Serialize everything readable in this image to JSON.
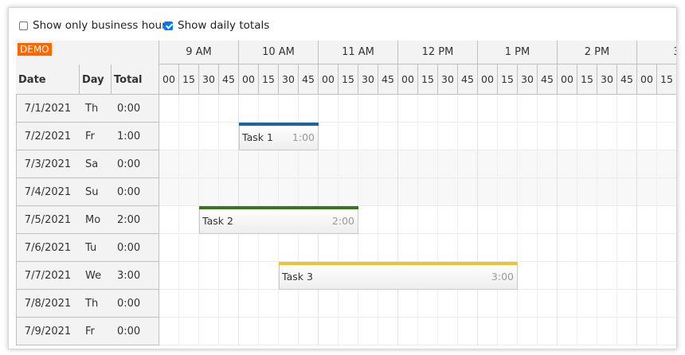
{
  "toolbar": {
    "business_hours_label": "Show only business hours",
    "business_hours_checked": false,
    "daily_totals_label": "Show daily totals",
    "daily_totals_checked": true
  },
  "corner": {
    "demo_badge": "DEMO",
    "columns": [
      "Date",
      "Day",
      "Total"
    ]
  },
  "timeline": {
    "hours": [
      "9 AM",
      "10 AM",
      "11 AM",
      "12 PM",
      "1 PM",
      "2 PM",
      "3"
    ],
    "minutes": [
      "00",
      "15",
      "30",
      "45"
    ]
  },
  "rows": [
    {
      "date": "7/1/2021",
      "day": "Th",
      "total": "0:00",
      "weekend": false
    },
    {
      "date": "7/2/2021",
      "day": "Fr",
      "total": "1:00",
      "weekend": false
    },
    {
      "date": "7/3/2021",
      "day": "Sa",
      "total": "0:00",
      "weekend": true
    },
    {
      "date": "7/4/2021",
      "day": "Su",
      "total": "0:00",
      "weekend": true
    },
    {
      "date": "7/5/2021",
      "day": "Mo",
      "total": "2:00",
      "weekend": false
    },
    {
      "date": "7/6/2021",
      "day": "Tu",
      "total": "0:00",
      "weekend": false
    },
    {
      "date": "7/7/2021",
      "day": "We",
      "total": "3:00",
      "weekend": false
    },
    {
      "date": "7/8/2021",
      "day": "Th",
      "total": "0:00",
      "weekend": false
    },
    {
      "date": "7/9/2021",
      "day": "Fr",
      "total": "0:00",
      "weekend": false
    }
  ],
  "events": [
    {
      "name": "Task 1",
      "duration": "1:00",
      "row": 1,
      "start": "10:00",
      "end": "11:00",
      "color": "#1f63a1"
    },
    {
      "name": "Task 2",
      "duration": "2:00",
      "row": 4,
      "start": "9:30",
      "end": "11:30",
      "color": "#38761d"
    },
    {
      "name": "Task 3",
      "duration": "3:00",
      "row": 6,
      "start": "10:30",
      "end": "13:30",
      "color": "#f1c232"
    }
  ]
}
